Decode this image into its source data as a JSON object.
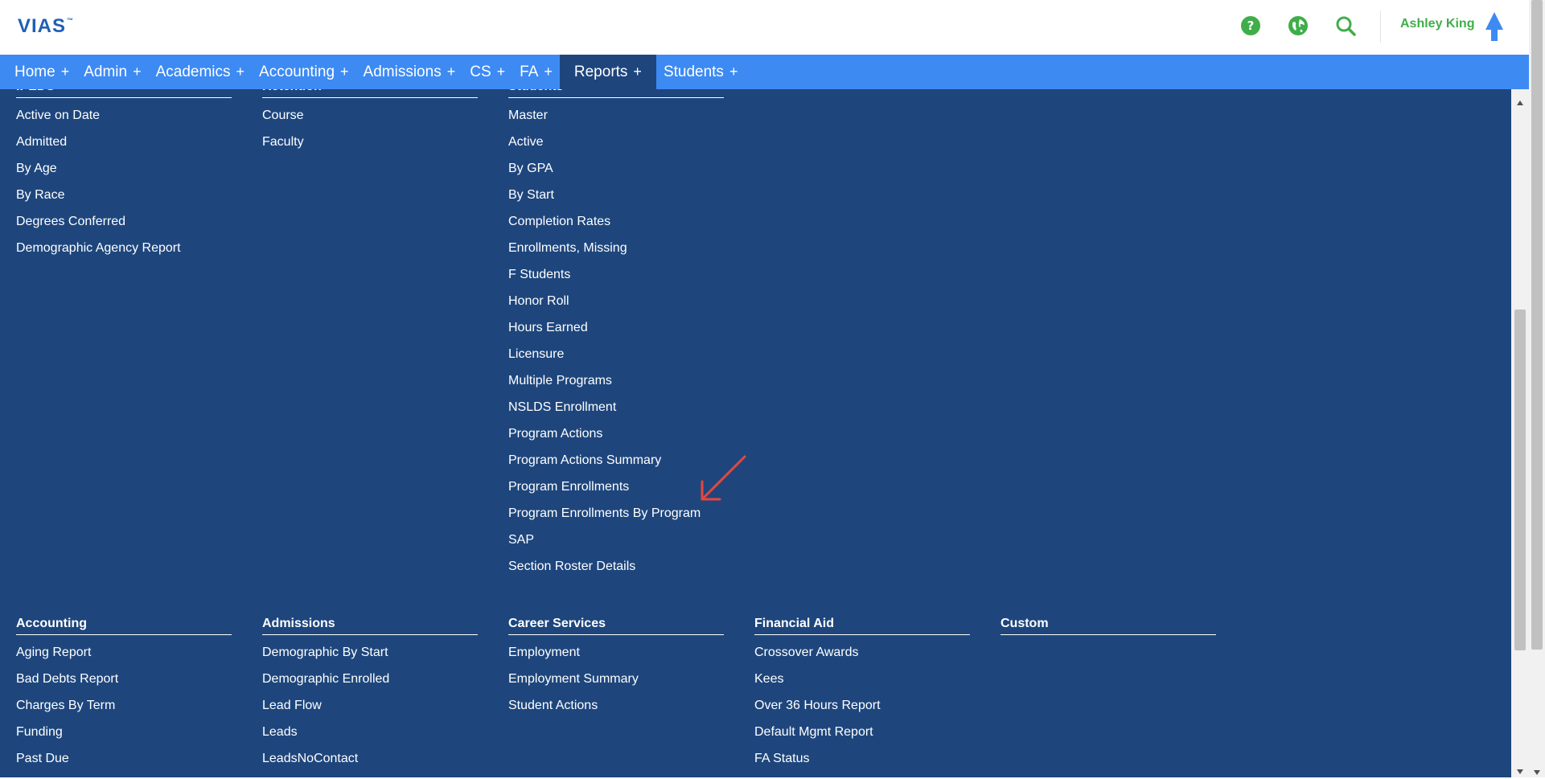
{
  "header": {
    "logo": "VIAS",
    "logo_tm": "™",
    "user_name": "Ashley King",
    "icons": [
      "help-icon",
      "globe-icon",
      "search-icon",
      "up-arrow-icon"
    ],
    "colors": {
      "icon_green": "#3fae49",
      "logo_blue": "#1f5fb5",
      "arrow_blue": "#3d8af3"
    }
  },
  "nav": {
    "items": [
      {
        "label": "Home",
        "plus": "+"
      },
      {
        "label": "Admin",
        "plus": "+"
      },
      {
        "label": "Academics",
        "plus": "+"
      },
      {
        "label": "Accounting",
        "plus": "+"
      },
      {
        "label": "Admissions",
        "plus": "+"
      },
      {
        "label": "CS",
        "plus": "+"
      },
      {
        "label": "FA",
        "plus": "+"
      },
      {
        "label": "Reports",
        "plus": "+",
        "active": true
      },
      {
        "label": "Students",
        "plus": "+"
      }
    ],
    "colors": {
      "bar": "#3d8af3",
      "active": "#1e467d"
    }
  },
  "menu": {
    "background": "#1e467d",
    "top_sections": [
      {
        "title": "IPEDS",
        "items": [
          "Active on Date",
          "Admitted",
          "By Age",
          "By Race",
          "Degrees Conferred",
          "Demographic Agency Report"
        ]
      },
      {
        "title": "Retention",
        "items": [
          "Course",
          "Faculty"
        ]
      },
      {
        "title": "Students",
        "items": [
          "Master",
          "Active",
          "By GPA",
          "By Start",
          "Completion Rates",
          "Enrollments, Missing",
          "F Students",
          "Honor Roll",
          "Hours Earned",
          "Licensure",
          "Multiple Programs",
          "NSLDS Enrollment",
          "Program Actions",
          "Program Actions Summary",
          "Program Enrollments",
          "Program Enrollments By Program",
          "SAP",
          "Section Roster Details"
        ]
      }
    ],
    "bottom_sections": [
      {
        "title": "Accounting",
        "items": [
          "Aging Report",
          "Bad Debts Report",
          "Charges By Term",
          "Funding",
          "Past Due"
        ]
      },
      {
        "title": "Admissions",
        "items": [
          "Demographic By Start",
          "Demographic Enrolled",
          "Lead Flow",
          "Leads",
          "LeadsNoContact"
        ]
      },
      {
        "title": "Career Services",
        "items": [
          "Employment",
          "Employment Summary",
          "Student Actions"
        ]
      },
      {
        "title": "Financial Aid",
        "items": [
          "Crossover Awards",
          "Kees",
          "Over 36 Hours Report",
          "Default Mgmt Report",
          "FA Status"
        ]
      },
      {
        "title": "Custom",
        "items": []
      }
    ],
    "annotation_color": "#e8463a"
  }
}
